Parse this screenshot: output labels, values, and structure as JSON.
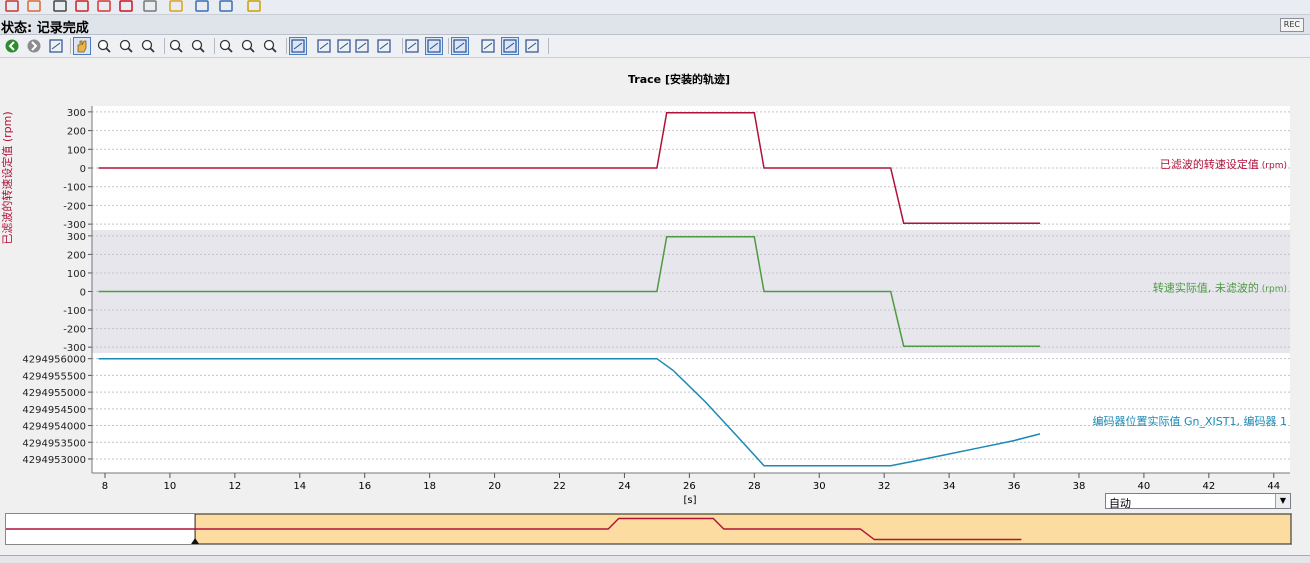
{
  "status": {
    "label": "状态: 记录完成",
    "rec_badge": "REC"
  },
  "range_combo": {
    "value": "自动"
  },
  "icons": {
    "top_toolbar": [
      "trace-icon",
      "config-icon",
      "glasses-icon",
      "record-icon",
      "stop-icon",
      "delete-icon",
      "settings-icon",
      "copy-icon",
      "chart-icon",
      "chart2-icon",
      "pin-icon"
    ],
    "toolbar2": [
      "back-icon",
      "forward-icon",
      "cursor-icon",
      "hand-icon",
      "zoom-select-icon",
      "zoom-x-icon",
      "zoom-y-icon",
      "zoom-in-icon",
      "zoom-out-icon",
      "zoom-100-icon",
      "zoom-y100-icon",
      "zoom-x100-icon",
      "show-all-icon",
      "measure-icon",
      "signal-icon",
      "trend-icon",
      "vertical-cursor-icon",
      "horizontal-cursor-icon",
      "export-icon",
      "list-icon",
      "align-left-icon",
      "align-justify-icon",
      "download-icon"
    ]
  },
  "chart_data": {
    "type": "line",
    "title": "Trace [安装的轨迹]",
    "xlabel": "[s]",
    "xlim": [
      7.6,
      44.5
    ],
    "x_ticks": [
      8,
      10,
      12,
      14,
      16,
      18,
      20,
      22,
      24,
      26,
      28,
      30,
      32,
      34,
      36,
      38,
      40,
      42,
      44
    ],
    "left_axis_label": "已滤波的转速设定值 (rpm)",
    "panels": [
      {
        "name": "已滤波的转速设定值",
        "unit": "(rpm)",
        "color": "#b0123a",
        "ylim": [
          -310,
          310
        ],
        "y_ticks": [
          300,
          200,
          100,
          0,
          -100,
          -200,
          -300
        ],
        "x": [
          7.8,
          25.0,
          25.3,
          28.0,
          28.3,
          32.2,
          32.6,
          36.8
        ],
        "values": [
          0,
          0,
          295,
          295,
          0,
          0,
          -295,
          -295
        ]
      },
      {
        "name": "转速实际值, 未滤波的",
        "unit": "(rpm)",
        "color": "#4e9b42",
        "ylim": [
          -310,
          310
        ],
        "y_ticks": [
          300,
          200,
          100,
          0,
          -100,
          -200,
          -300
        ],
        "x": [
          7.8,
          25.0,
          25.3,
          28.0,
          28.3,
          32.2,
          32.6,
          36.8
        ],
        "values": [
          0,
          0,
          295,
          295,
          0,
          0,
          -295,
          -295
        ]
      },
      {
        "name": "编码器位置实际值 Gn_XIST1, 编码器 1",
        "unit": "",
        "color": "#1a89b5",
        "ylim": [
          4294952700,
          4294956050
        ],
        "y_ticks": [
          4294956000,
          4294955500,
          4294955000,
          4294954500,
          4294954000,
          4294953500,
          4294953000
        ],
        "x": [
          7.8,
          25.0,
          25.5,
          26.5,
          27.5,
          28.3,
          32.2,
          33.0,
          34.0,
          35.0,
          36.0,
          36.8
        ],
        "values": [
          4294956000,
          4294956000,
          4294955650,
          4294954700,
          4294953650,
          4294952800,
          4294952800,
          4294952950,
          4294953150,
          4294953350,
          4294953550,
          4294953750
        ]
      }
    ],
    "overview": {
      "x": [
        7.8,
        25.0,
        25.3,
        28.0,
        28.3,
        32.2,
        32.6,
        36.8
      ],
      "values": [
        0,
        0,
        295,
        295,
        0,
        0,
        -295,
        -295
      ]
    }
  }
}
